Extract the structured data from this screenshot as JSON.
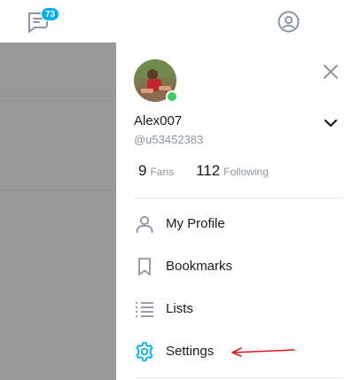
{
  "topbar": {
    "messages_badge": "73",
    "chat_icon": "chat-bubble-icon",
    "account_icon": "account-circle-icon"
  },
  "colors": {
    "accent": "#00aff0",
    "online": "#3dcb5e",
    "overlay": "#999999",
    "annotation_arrow": "#d9141c"
  },
  "profile": {
    "display_name": "Alex007",
    "handle": "@u53452383",
    "fans_count": "9",
    "fans_label": "Fans",
    "following_count": "112",
    "following_label": "Following"
  },
  "menu": {
    "items": [
      {
        "label": "My Profile",
        "icon": "person-icon"
      },
      {
        "label": "Bookmarks",
        "icon": "bookmark-icon"
      },
      {
        "label": "Lists",
        "icon": "list-icon"
      },
      {
        "label": "Settings",
        "icon": "gear-icon"
      }
    ]
  }
}
